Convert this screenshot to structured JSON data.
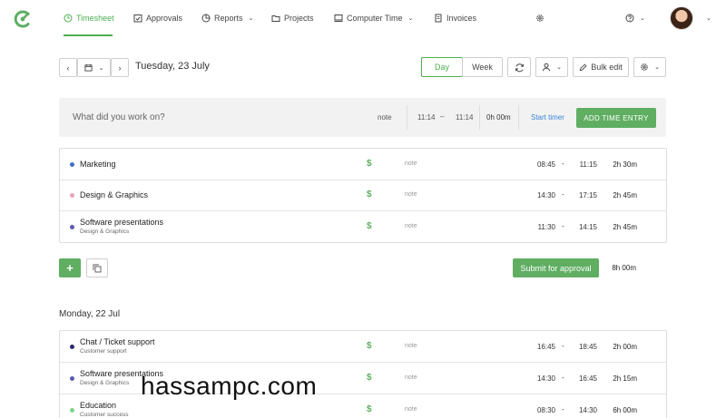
{
  "nav": {
    "items": [
      {
        "label": "Timesheet",
        "icon": "clock-icon",
        "active": true
      },
      {
        "label": "Approvals",
        "icon": "approvals-icon"
      },
      {
        "label": "Reports",
        "icon": "reports-icon"
      },
      {
        "label": "Projects",
        "icon": "folder-icon"
      },
      {
        "label": "Computer Time",
        "icon": "monitor-icon"
      },
      {
        "label": "Invoices",
        "icon": "invoice-icon"
      }
    ],
    "brand_color": "#4caf50"
  },
  "toolbar": {
    "date": "Tuesday, 23 July",
    "day_label": "Day",
    "week_label": "Week",
    "bulk_edit_label": "Bulk edit"
  },
  "entry": {
    "placeholder": "What did you work on?",
    "note": "note",
    "start": "11:14",
    "dash": "–",
    "end": "11:14",
    "duration": "0h 00m",
    "start_timer": "Start timer",
    "add_label": "ADD TIME ENTRY"
  },
  "today": {
    "entries": [
      {
        "project": "Marketing",
        "client": "",
        "dot": "#3f6fc6",
        "note": "note",
        "start": "08:45",
        "dash": "-",
        "end": "11:15",
        "duration": "2h 30m"
      },
      {
        "project": "Design & Graphics",
        "client": "",
        "dot": "#e6a3b8",
        "note": "note",
        "start": "14:30",
        "dash": "-",
        "end": "17:15",
        "duration": "2h 45m"
      },
      {
        "project": "Software presentations",
        "client": "Design & Graphics",
        "dot": "#5b5bb0",
        "note": "note",
        "start": "11:30",
        "dash": "-",
        "end": "14:15",
        "duration": "2h 45m"
      }
    ],
    "add_symbol": "+",
    "submit_label": "Submit for approval",
    "total": "8h 00m"
  },
  "previous": {
    "title": "Monday, 22 Jul",
    "entries": [
      {
        "project": "Chat / Ticket support",
        "client": "Customer support",
        "dot": "#2a2a6a",
        "note": "note",
        "start": "16:45",
        "dash": "-",
        "end": "18:45",
        "duration": "2h 00m"
      },
      {
        "project": "Software presentations",
        "client": "Design & Graphics",
        "dot": "#5b5bb0",
        "note": "note",
        "start": "14:30",
        "dash": "-",
        "end": "16:45",
        "duration": "2h 15m"
      },
      {
        "project": "Education",
        "client": "Customer success",
        "dot": "#7ed38a",
        "note": "note",
        "start": "08:30",
        "dash": "-",
        "end": "14:30",
        "duration": "6h 00m"
      }
    ]
  },
  "watermark": "hassampc.com"
}
